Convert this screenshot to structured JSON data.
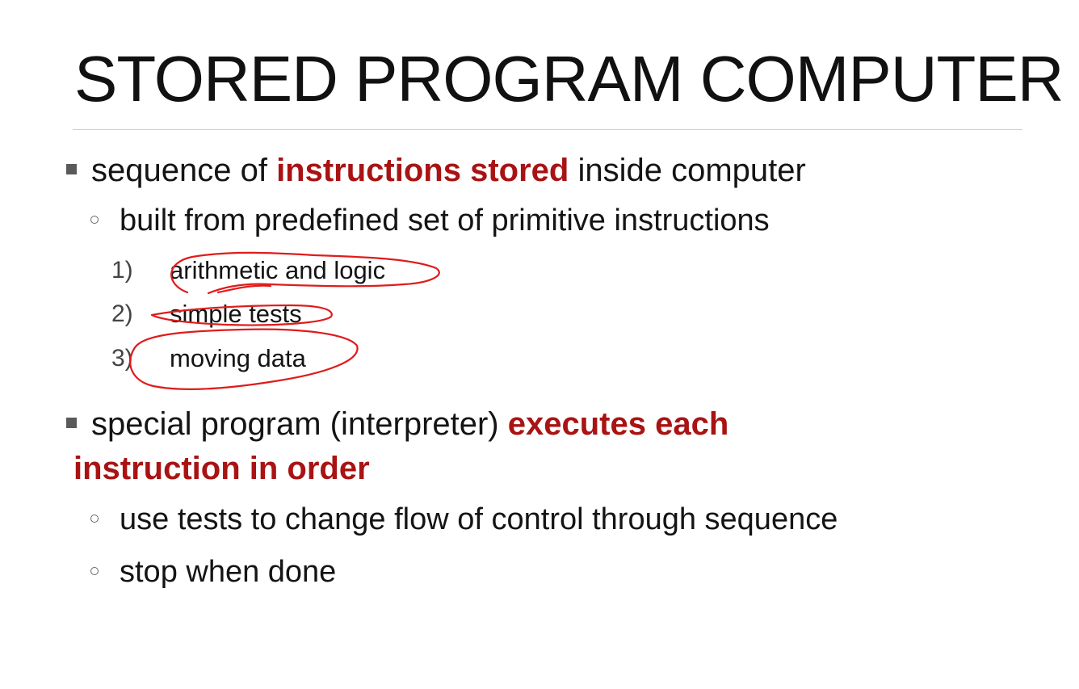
{
  "slide": {
    "title": "STORED PROGRAM COMPUTER",
    "bullet1": {
      "pre": "sequence of ",
      "highlight": "instructions stored",
      "post": " inside computer"
    },
    "bullet1_sub": "built from predefined set of primitive instructions",
    "primitives": [
      {
        "number": "1)",
        "text": "arithmetic and logic"
      },
      {
        "number": "2)",
        "text": "simple tests"
      },
      {
        "number": "3)",
        "text": "moving data"
      }
    ],
    "bullet2": {
      "pre": "special program (interpreter) ",
      "highlight_line1": "executes each",
      "highlight_line2": "instruction in order"
    },
    "bullet2_subs": [
      "use tests to change flow of control through sequence",
      "stop when done"
    ]
  },
  "colors": {
    "highlight": "#a91313",
    "ink_annotation": "#e01b1b",
    "text": "#141414"
  }
}
